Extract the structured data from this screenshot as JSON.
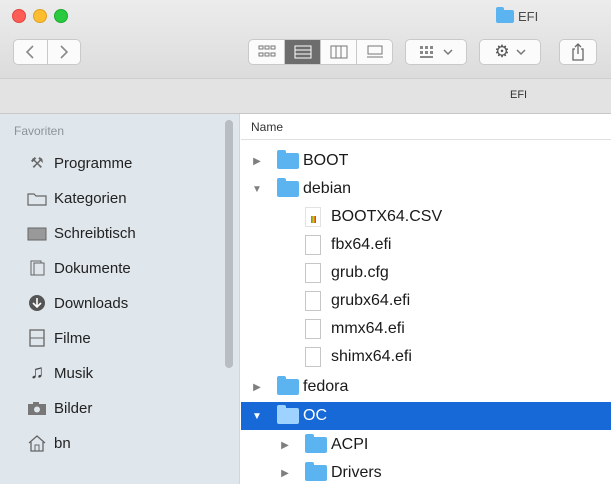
{
  "window": {
    "title": "EFI",
    "path_label": "EFI"
  },
  "toolbar": {
    "back_icon": "chevron-left",
    "forward_icon": "chevron-right",
    "view_modes": [
      "icon-view",
      "list-view",
      "column-view",
      "gallery-view"
    ],
    "active_view": "list-view",
    "arrange_icon": "grid-arrange",
    "action_icon": "gear",
    "share_icon": "share"
  },
  "sidebar": {
    "heading": "Favoriten",
    "items": [
      {
        "label": "Programme",
        "icon": "applications-icon"
      },
      {
        "label": "Kategorien",
        "icon": "folder-icon"
      },
      {
        "label": "Schreibtisch",
        "icon": "desktop-icon"
      },
      {
        "label": "Dokumente",
        "icon": "documents-icon"
      },
      {
        "label": "Downloads",
        "icon": "downloads-icon"
      },
      {
        "label": "Filme",
        "icon": "movies-icon"
      },
      {
        "label": "Musik",
        "icon": "music-icon"
      },
      {
        "label": "Bilder",
        "icon": "pictures-icon"
      },
      {
        "label": "bn",
        "icon": "home-icon"
      }
    ]
  },
  "filelist": {
    "column_header": "Name",
    "rows": [
      {
        "name": "BOOT",
        "type": "folder",
        "expanded": false
      },
      {
        "name": "debian",
        "type": "folder",
        "expanded": true
      },
      {
        "name": "BOOTX64.CSV",
        "type": "csv"
      },
      {
        "name": "fbx64.efi",
        "type": "file"
      },
      {
        "name": "grub.cfg",
        "type": "file"
      },
      {
        "name": "grubx64.efi",
        "type": "file"
      },
      {
        "name": "mmx64.efi",
        "type": "file"
      },
      {
        "name": "shimx64.efi",
        "type": "file"
      },
      {
        "name": "fedora",
        "type": "folder",
        "expanded": false
      },
      {
        "name": "OC",
        "type": "folder",
        "expanded": true,
        "selected": true
      },
      {
        "name": "ACPI",
        "type": "folder",
        "expanded": false
      },
      {
        "name": "Drivers",
        "type": "folder",
        "expanded": false
      }
    ]
  },
  "colors": {
    "selection": "#1669d6",
    "folder": "#5bb4f0",
    "sidebar_bg": "#dfe6ec"
  }
}
